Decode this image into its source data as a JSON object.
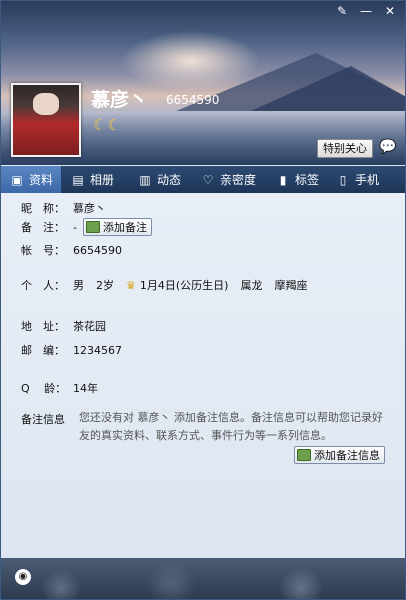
{
  "window": {
    "minimize_glyph": "—",
    "close_glyph": "✕",
    "skin_glyph": "✎"
  },
  "profile": {
    "nickname": "慕彦丶",
    "qq": "6654590",
    "level_glyph": "☾☾",
    "special_care_label": "特别关心",
    "chat_icon": "💬"
  },
  "tabs": [
    {
      "label": "资料",
      "icon": "id-card-icon",
      "glyph": "▣"
    },
    {
      "label": "相册",
      "icon": "photo-icon",
      "glyph": "▤"
    },
    {
      "label": "动态",
      "icon": "feed-icon",
      "glyph": "▥"
    },
    {
      "label": "亲密度",
      "icon": "heart-icon",
      "glyph": "♡"
    },
    {
      "label": "标签",
      "icon": "bookmark-icon",
      "glyph": "▮"
    },
    {
      "label": "手机",
      "icon": "phone-icon",
      "glyph": "▯"
    }
  ],
  "info": {
    "nickname_label": "昵　称：",
    "nickname_value": "慕彦丶",
    "remark_label": "备　注：",
    "remark_value": "-",
    "add_remark_label": "添加备注",
    "account_label": "帐　号：",
    "account_value": "6654590",
    "personal_label": "个　人：",
    "gender": "男",
    "age": "2岁",
    "birthday": "1月4日(公历生日)",
    "zodiac": "属龙",
    "constellation": "摩羯座",
    "address_label": "地　址：",
    "address_value": "茶花园",
    "postcode_label": "邮　编：",
    "postcode_value": "1234567",
    "qage_label": "Q　 龄：",
    "qage_value": "14年",
    "note_label": "备注信息",
    "note_text": "您还没有对 慕彦丶 添加备注信息。备注信息可以帮助您记录好友的真实资料、联系方式、事件行为等一系列信息。",
    "add_note_label": "添加备注信息"
  },
  "footer": {
    "icon_glyph": "◉"
  },
  "colors": {
    "tab_bar": "#1d3557",
    "active_tab": "#4a78b8",
    "body_bg": "#e4ebf4",
    "crown": "#d9a416"
  }
}
